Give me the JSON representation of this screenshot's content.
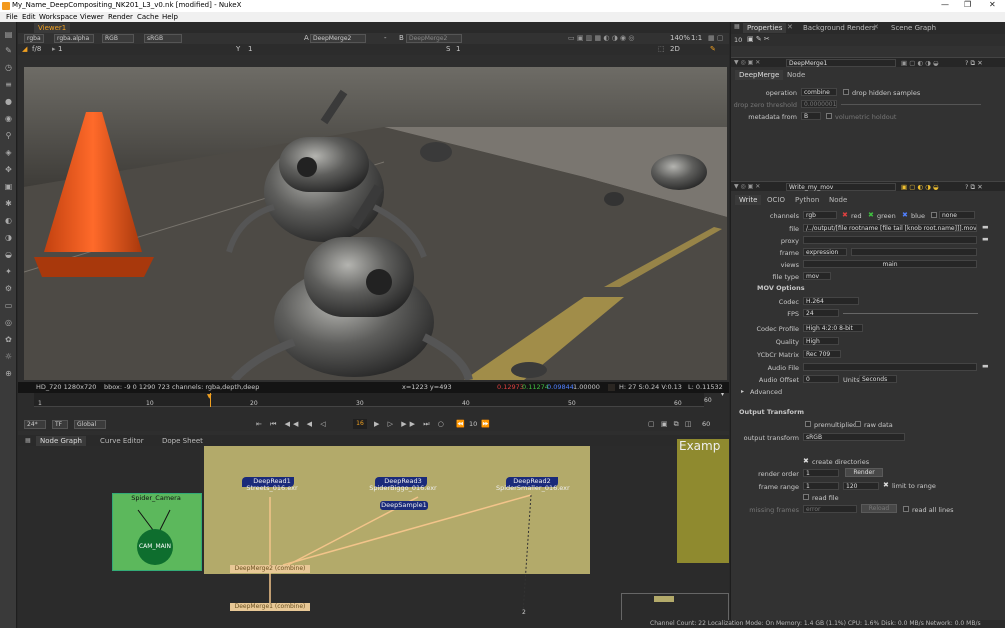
{
  "window": {
    "title": "My_Name_DeepCompositing_NK201_L3_v0.nk [modified] - NukeX",
    "controls": [
      "—",
      "❐",
      "✕"
    ]
  },
  "menu": [
    "File",
    "Edit",
    "Workspace",
    "Viewer",
    "Render",
    "Cache",
    "Help"
  ],
  "viewer": {
    "tab": "Viewer1",
    "channels": "rgba",
    "alpha": "rgba.alpha",
    "rgb": "RGB",
    "lut": "sRGB",
    "input_a_label": "A",
    "input_a": "DeepMerge2",
    "input_a_sep": "-",
    "input_b_label": "B",
    "input_b": "DeepMerge2",
    "zoom": "140%",
    "ratio": "1:1",
    "gain_label": "f/8",
    "gain_value": "1",
    "y_label": "Y",
    "y_value": "1",
    "gamma_label": "S",
    "gamma_value": "1",
    "view_mode": "2D",
    "format": "HD_720 1280x720",
    "bbox": "bbox: -9 0 1290 723 channels: rgba,depth,deep",
    "coords": "x=1223 y=493",
    "val_r": "0.12973",
    "val_g": "0.11274",
    "val_b": "0.09844",
    "val_a": "1.00000",
    "hsv": "H: 27 S:0.24 V:0.13",
    "lum": "L: 0.11532"
  },
  "timeline": {
    "ticks": [
      "1",
      "10",
      "20",
      "30",
      "40",
      "50",
      "60"
    ],
    "end_frame": "60",
    "fps": "24*",
    "tf": "TF",
    "scope": "Global",
    "current_frame": "16",
    "step": "10",
    "out_frame": "60"
  },
  "bottom_tabs": [
    "Node Graph",
    "Curve Editor",
    "Dope Sheet"
  ],
  "nodes": {
    "deepread1": "DeepRead1\nStreets_016.exr",
    "deepread3": "DeepRead3\nSpiderBiggo_016.exr",
    "deepread2": "DeepRead2\nSpiderSmaller_016.exr",
    "deepsample": "DeepSample1",
    "camera": "Spider_Camera",
    "cam_main": "CAM_MAIN",
    "merge2": "DeepMerge2 (combine)",
    "merge1": "DeepMerge1 (combine)",
    "backdrop_text": "Examp",
    "num2": "2"
  },
  "props_tabs": [
    "Properties",
    "Background Renders",
    "Scene Graph"
  ],
  "props_count": "10",
  "deepmerge": {
    "name": "DeepMerge1",
    "tabs": [
      "DeepMerge",
      "Node"
    ],
    "operation_label": "operation",
    "operation": "combine",
    "drop_hidden": "drop hidden samples",
    "drop_zero_label": "drop zero threshold",
    "drop_zero": "0.0000001",
    "metadata_label": "metadata from",
    "metadata": "B",
    "volumetric": "volumetric holdout"
  },
  "write": {
    "name": "Write_my_mov",
    "tabs": [
      "Write",
      "OCIO",
      "Python",
      "Node"
    ],
    "channels_label": "channels",
    "channels": "rgb",
    "red": "red",
    "green": "green",
    "blue": "blue",
    "alpha_opt": "none",
    "file_label": "file",
    "file": "/../output/[file rootname [file tail [knob root.name]]].mov",
    "proxy_label": "proxy",
    "frame_label": "frame",
    "frame": "expression",
    "views_label": "views",
    "views": "main",
    "filetype_label": "file type",
    "filetype": "mov",
    "mov_options": "MOV Options",
    "codec_label": "Codec",
    "codec": "H.264",
    "fps_label": "FPS",
    "fps": "24",
    "profile_label": "Codec Profile",
    "profile": "High 4:2:0 8-bit",
    "quality_label": "Quality",
    "quality": "High",
    "matrix_label": "YCbCr Matrix",
    "matrix": "Rec 709",
    "audio_label": "Audio File",
    "offset_label": "Audio Offset",
    "offset": "0",
    "units_label": "Units",
    "units": "Seconds",
    "advanced": "Advanced",
    "output_transform_hdr": "Output Transform",
    "premultiplied": "premultiplied",
    "raw": "raw data",
    "ot_label": "output transform",
    "ot": "sRGB",
    "create_dirs": "create directories",
    "order_label": "render order",
    "order": "1",
    "render_btn": "Render",
    "range_label": "frame range",
    "range_start": "1",
    "range_end": "120",
    "limit": "limit to range",
    "read_file": "read file",
    "missing_label": "missing frames",
    "missing": "error",
    "reload": "Reload",
    "read_all": "read all lines"
  },
  "status": "Channel Count: 22  Localization Mode: On  Memory: 1.4 GB (1.1%)  CPU: 1.6%  Disk: 0.0 MB/s  Network: 0.0 MB/s"
}
